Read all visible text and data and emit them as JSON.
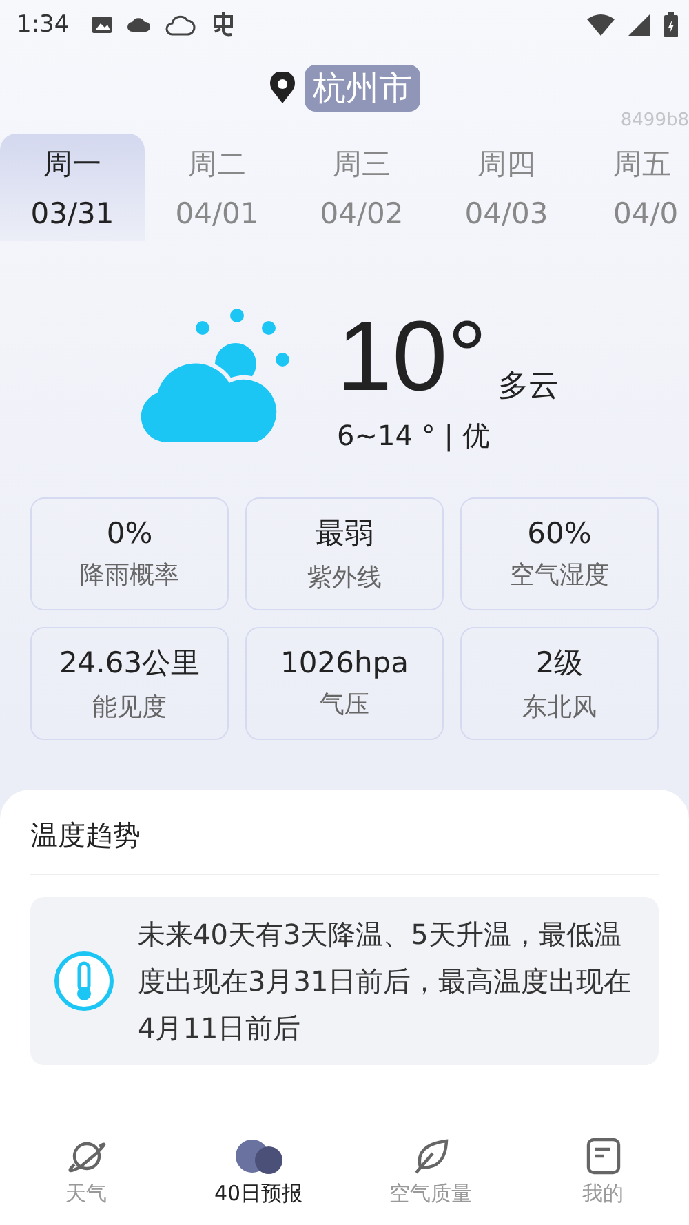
{
  "status_bar": {
    "time": "1:34"
  },
  "location": {
    "city": "杭州市"
  },
  "debug_text": "8499b8",
  "days": [
    {
      "weekday": "周一",
      "date": "03/31",
      "selected": true
    },
    {
      "weekday": "周二",
      "date": "04/01",
      "selected": false
    },
    {
      "weekday": "周三",
      "date": "04/02",
      "selected": false
    },
    {
      "weekday": "周四",
      "date": "04/03",
      "selected": false
    },
    {
      "weekday": "周五",
      "date": "04/0",
      "selected": false
    }
  ],
  "current": {
    "temperature": "10°",
    "condition": "多云",
    "range": "6~14 ° | 优"
  },
  "details": [
    {
      "value": "0%",
      "label": "降雨概率"
    },
    {
      "value": "最弱",
      "label": "紫外线"
    },
    {
      "value": "60%",
      "label": "空气湿度"
    },
    {
      "value": "24.63公里",
      "label": "能见度"
    },
    {
      "value": "1026hpa",
      "label": "气压"
    },
    {
      "value": "2级",
      "label": "东北风"
    }
  ],
  "trend": {
    "title": "温度趋势",
    "summary": "未来40天有3天降温、5天升温，最低温度出现在3月31日前后，最高温度出现在4月11日前后"
  },
  "nav": [
    {
      "kind": "planet",
      "label": "天气",
      "selected": false
    },
    {
      "kind": "cloud",
      "label": "40日预报",
      "selected": true
    },
    {
      "kind": "leaf",
      "label": "空气质量",
      "selected": false
    },
    {
      "kind": "note",
      "label": "我的",
      "selected": false
    }
  ]
}
